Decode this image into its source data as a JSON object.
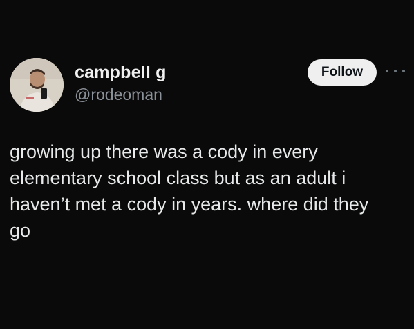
{
  "author": {
    "display_name": "campbell g",
    "handle": "@rodeoman",
    "avatar_icon": "profile-photo"
  },
  "actions": {
    "follow_label": "Follow",
    "more_icon": "more-options-icon"
  },
  "post": {
    "text": "growing up there was a cody in every\nelementary school class but as an adult i\nhaven’t met a cody in years. where did they\ngo"
  },
  "colors": {
    "background": "#0a0a0a",
    "text": "#e7e9ea",
    "secondary_text": "#8b9198",
    "follow_button_bg": "#efefef"
  }
}
